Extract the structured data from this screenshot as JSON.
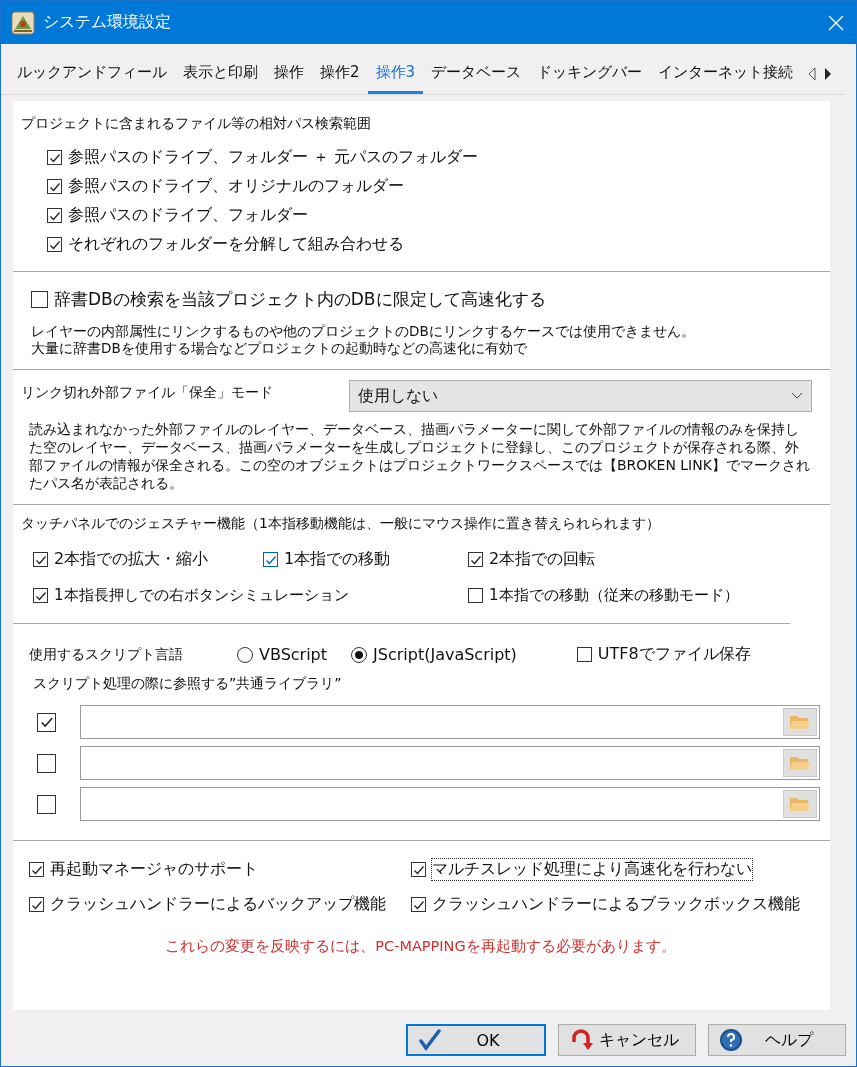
{
  "window": {
    "title": "システム環境設定"
  },
  "tabs": [
    {
      "label": "ルックアンドフィール",
      "selected": false
    },
    {
      "label": "表示と印刷",
      "selected": false
    },
    {
      "label": "操作",
      "selected": false
    },
    {
      "label": "操作2",
      "selected": false
    },
    {
      "label": "操作3",
      "selected": true
    },
    {
      "label": "データベース",
      "selected": false
    },
    {
      "label": "ドッキングバー",
      "selected": false
    },
    {
      "label": "インターネット接続",
      "selected": false
    }
  ],
  "search_scope": {
    "heading": "プロジェクトに含まれるファイル等の相対パス検索範囲",
    "options": [
      {
        "label": "参照パスのドライブ、フォルダー ＋ 元パスのフォルダー",
        "checked": true
      },
      {
        "label": "参照パスのドライブ、オリジナルのフォルダー",
        "checked": true
      },
      {
        "label": "参照パスのドライブ、フォルダー",
        "checked": true
      },
      {
        "label": "それぞれのフォルダーを分解して組み合わせる",
        "checked": true
      }
    ]
  },
  "dictionary_db": {
    "label": "辞書DBの検索を当該プロジェクト内のDBに限定して高速化する",
    "checked": false,
    "notes": [
      "レイヤーの内部属性にリンクするものや他のプロジェクトのDBにリンクするケースでは使用できません。",
      "大量に辞書DBを使用する場合などプロジェクトの起動時などの高速化に有効で"
    ]
  },
  "broken_link": {
    "label": "リンク切れ外部ファイル「保全」モード",
    "dropdown": {
      "value": "使用しない"
    },
    "description": "読み込まれなかった外部ファイルのレイヤー、データベース、描画パラメーターに関して外部ファイルの情報のみを保持した空のレイヤー、データベース、描画パラメーターを生成しプロジェクトに登録し、このプロジェクトが保存される際、外部ファイルの情報が保全される。この空のオブジェクトはプロジェクトワークスペースでは【BROKEN LINK】でマークされたパス名が表記される。"
  },
  "gesture": {
    "heading": "タッチパネルでのジェスチャー機能（1本指移動機能は、一般にマウス操作に置き替えられられます）",
    "options": [
      {
        "label": "2本指での拡大・縮小",
        "checked": true
      },
      {
        "label": "1本指での移動",
        "checked": true
      },
      {
        "label": "2本指での回転",
        "checked": true
      },
      {
        "label": "1本指長押しでの右ボタンシミュレーション",
        "checked": true
      },
      {
        "label": "1本指での移動（従来の移動モード）",
        "checked": false
      }
    ]
  },
  "script": {
    "label": "使用するスクリプト言語",
    "languages": [
      {
        "label": "VBScript",
        "selected": false
      },
      {
        "label": "JScript(JavaScript)",
        "selected": true
      }
    ],
    "utf8": {
      "label": "UTF8でファイル保存",
      "checked": false
    },
    "library_heading": "スクリプト処理の際に参照する”共通ライブラリ”",
    "libraries": [
      {
        "checked": true
      },
      {
        "checked": false
      },
      {
        "checked": false
      }
    ]
  },
  "misc": [
    {
      "label": "再起動マネージャのサポート",
      "checked": true,
      "focused": false
    },
    {
      "label": "マルチスレッド処理により高速化を行わない",
      "checked": true,
      "focused": true
    },
    {
      "label": "クラッシュハンドラーによるバックアップ機能",
      "checked": true,
      "focused": false
    },
    {
      "label": "クラッシュハンドラーによるブラックボックス機能",
      "checked": true,
      "focused": false
    }
  ],
  "notice": "これらの変更を反映するには、PC-MAPPINGを再起動する必要があります。",
  "buttons": [
    {
      "label": "OK",
      "kind": "ok"
    },
    {
      "label": "キャンセル",
      "kind": "cancel"
    },
    {
      "label": "ヘルプ",
      "kind": "help"
    }
  ]
}
